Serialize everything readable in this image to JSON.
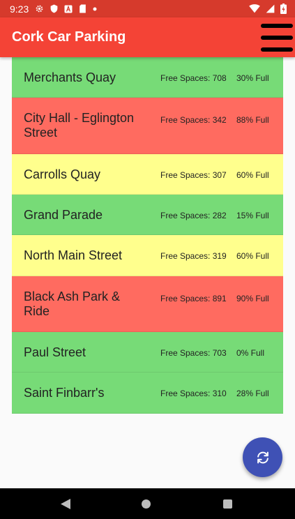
{
  "status_bar": {
    "time": "9:23",
    "icons": [
      "settings-icon",
      "shield-icon",
      "a-icon",
      "sd-card-icon",
      "dot-icon",
      "wifi-icon",
      "signal-icon",
      "battery-icon"
    ]
  },
  "app_bar": {
    "title": "Cork Car Parking",
    "menu_icon": "hamburger-menu-icon"
  },
  "colors": {
    "app_bar": "#f44336",
    "status_bar": "#d63a2c",
    "low": "#77db77",
    "medium": "#ffff8d",
    "high": "#ff6b60",
    "fab": "#3f51b5"
  },
  "car_parks": [
    {
      "name": "Merchants Quay",
      "free_spaces": "Free Spaces: 708",
      "full": "30% Full",
      "status": "low"
    },
    {
      "name": "City Hall - Eglington Street",
      "free_spaces": "Free Spaces: 342",
      "full": "88% Full",
      "status": "high"
    },
    {
      "name": "Carrolls Quay",
      "free_spaces": "Free Spaces: 307",
      "full": "60% Full",
      "status": "medium"
    },
    {
      "name": "Grand Parade",
      "free_spaces": "Free Spaces: 282",
      "full": "15% Full",
      "status": "low"
    },
    {
      "name": "North Main Street",
      "free_spaces": "Free Spaces: 319",
      "full": "60% Full",
      "status": "medium"
    },
    {
      "name": "Black Ash Park & Ride",
      "free_spaces": "Free Spaces: 891",
      "full": "90% Full",
      "status": "high"
    },
    {
      "name": "Paul Street",
      "free_spaces": "Free Spaces: 703",
      "full": "0% Full",
      "status": "low"
    },
    {
      "name": "Saint Finbarr's",
      "free_spaces": "Free Spaces: 310",
      "full": "28% Full",
      "status": "low"
    }
  ],
  "fab": {
    "icon": "refresh-icon"
  },
  "nav_bar": {
    "icons": [
      "back-icon",
      "home-icon",
      "recents-icon"
    ]
  }
}
